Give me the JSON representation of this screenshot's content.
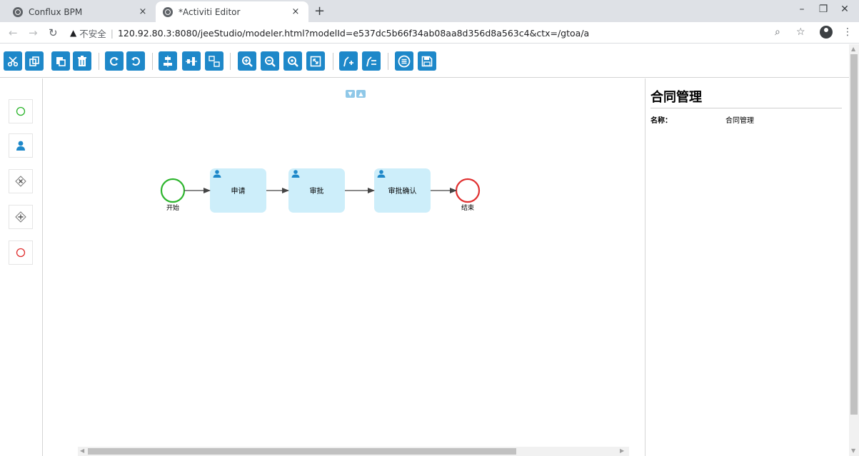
{
  "browser": {
    "tabs": [
      {
        "title": "Conflux BPM",
        "active": false
      },
      {
        "title": "*Activiti Editor",
        "active": true
      }
    ],
    "new_tab_glyph": "+",
    "close_glyph": "×",
    "security_label": "不安全",
    "url": "120.92.80.3:8080/jeeStudio/modeler.html?modelId=e537dc5b66f34ab08aa8d356d8a563c4&ctx=/gtoa/a"
  },
  "toolbar": {
    "groups": [
      [
        "cut-icon",
        "copy-icon",
        "paste-icon",
        "delete-icon"
      ],
      [
        "redo-icon",
        "undo-icon"
      ],
      [
        "align-vertical-icon",
        "align-horizontal-icon",
        "same-size-icon"
      ],
      [
        "zoom-in-icon",
        "zoom-out-icon",
        "zoom-actual-icon",
        "zoom-fit-icon"
      ],
      [
        "add-bendpoint-icon",
        "remove-bendpoint-icon"
      ],
      [
        "validate-icon",
        "save-icon"
      ]
    ]
  },
  "palette": {
    "items": [
      "start-event-icon",
      "user-task-icon",
      "exclusive-gateway-icon",
      "parallel-gateway-icon",
      "end-event-icon"
    ]
  },
  "diagram": {
    "start_label": "开始",
    "end_label": "结束",
    "tasks": [
      {
        "label": "申请"
      },
      {
        "label": "审批"
      },
      {
        "label": "审批确认"
      }
    ],
    "colors": {
      "start": "#2db52d",
      "end": "#e03030",
      "task_fill": "#cdeefa",
      "accent": "#1e88c9"
    }
  },
  "properties": {
    "title": "合同管理",
    "name_key": "名称：",
    "name_value": "合同管理"
  }
}
